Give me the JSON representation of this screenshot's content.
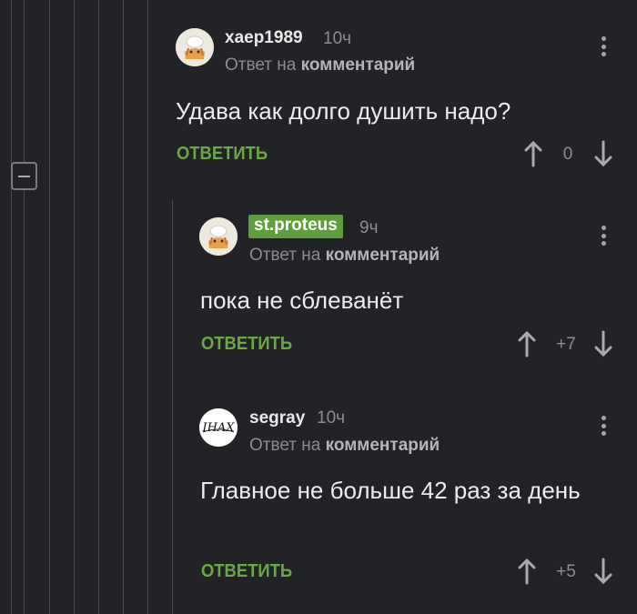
{
  "comments": [
    {
      "username": "xaep1989",
      "time": "10ч",
      "reply_prefix": "Ответ на",
      "reply_link": "комментарий",
      "text": "Удава как долго душить надо?",
      "reply_label": "ОТВЕТИТЬ",
      "rating": "0"
    },
    {
      "username": "st.proteus",
      "time": "9ч",
      "reply_prefix": "Ответ на",
      "reply_link": "комментарий",
      "text": "пока не сблеванёт",
      "reply_label": "ОТВЕТИТЬ",
      "rating": "+7"
    },
    {
      "username": "segray",
      "time": "10ч",
      "reply_prefix": "Ответ на",
      "reply_link": "комментарий",
      "text": "Главное не больше 42 раз за день",
      "reply_label": "ОТВЕТИТЬ",
      "rating": "+5",
      "avatar_text": "IHAX"
    }
  ],
  "colors": {
    "background": "#222326",
    "accent_green": "#6aa842",
    "badge_green": "#5e9e3c",
    "muted": "#8b8c90"
  },
  "icons": {
    "upvote": "arrow-up-icon",
    "downvote": "arrow-down-icon",
    "menu": "kebab-menu-icon",
    "collapse": "minus-icon"
  }
}
